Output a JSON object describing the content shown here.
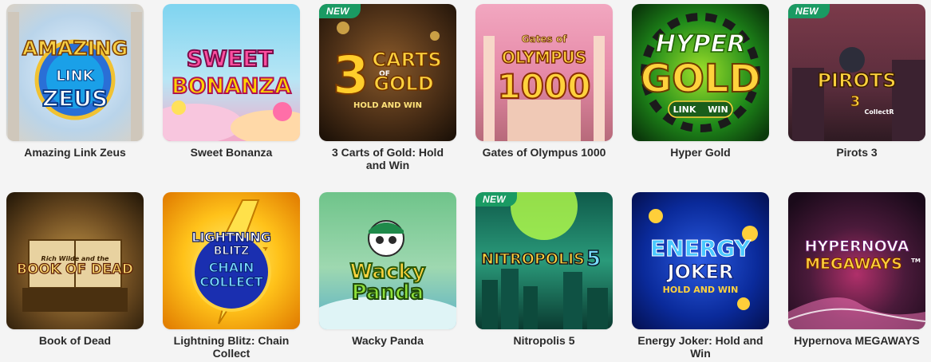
{
  "badge_label": "NEW",
  "games": [
    {
      "title": "Amazing Link Zeus",
      "is_new": false,
      "logo_lines": [
        "AMAZING",
        "LINK",
        "ZEUS"
      ]
    },
    {
      "title": "Sweet Bonanza",
      "is_new": false,
      "logo_lines": [
        "SWEET",
        "BONANZA"
      ]
    },
    {
      "title": "3 Carts of Gold: Hold and Win",
      "is_new": true,
      "logo_lines": [
        "3",
        "CARTS",
        "OF",
        "GOLD",
        "HOLD AND WIN"
      ]
    },
    {
      "title": "Gates of Olympus 1000",
      "is_new": false,
      "logo_lines": [
        "Gates of",
        "OLYMPUS",
        "1000"
      ]
    },
    {
      "title": "Hyper Gold",
      "is_new": false,
      "logo_lines": [
        "HYPER",
        "GOLD",
        "LINK",
        "WIN"
      ]
    },
    {
      "title": "Pirots 3",
      "is_new": true,
      "logo_lines": [
        "PIROTS",
        "3",
        "CollectR"
      ]
    },
    {
      "title": "Book of Dead",
      "is_new": false,
      "logo_lines": [
        "Rich Wilde and the",
        "BOOK OF DEAD"
      ]
    },
    {
      "title": "Lightning Blitz: Chain Collect",
      "is_new": false,
      "logo_lines": [
        "LIGHTNING",
        "BLITZ",
        "CHAIN",
        "COLLECT"
      ]
    },
    {
      "title": "Wacky Panda",
      "is_new": false,
      "logo_lines": [
        "Wacky",
        "Panda"
      ]
    },
    {
      "title": "Nitropolis 5",
      "is_new": true,
      "logo_lines": [
        "NITROPOLIS",
        "5"
      ]
    },
    {
      "title": "Energy Joker: Hold and Win",
      "is_new": false,
      "logo_lines": [
        "ENERGY",
        "JOKER",
        "HOLD AND WIN"
      ]
    },
    {
      "title": "Hypernova MEGAWAYS",
      "is_new": false,
      "logo_lines": [
        "HYPERNOVA",
        "MEGAWAYS",
        "TM"
      ]
    }
  ]
}
